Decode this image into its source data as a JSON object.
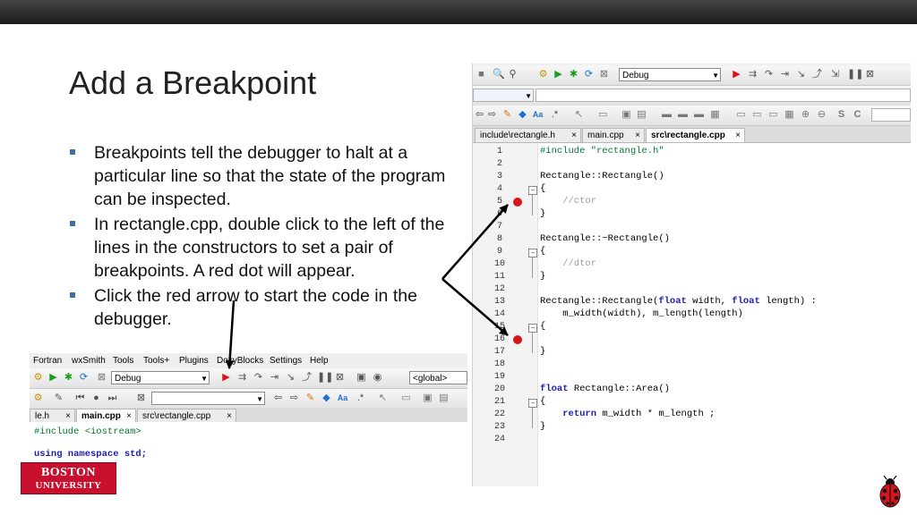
{
  "slide": {
    "title": "Add a Breakpoint",
    "bullets": [
      "Breakpoints tell the debugger to halt at a particular line so that the state of the program can be inspected.",
      "In rectangle.cpp, double click to the left of the lines in the constructors to set a pair of breakpoints. A red dot will appear.",
      "Click the red arrow to start the code in the debugger."
    ],
    "logo": {
      "line1": "BOSTON",
      "line2": "UNIVERSITY"
    }
  },
  "ide_right": {
    "build_target": "Debug",
    "tabs": [
      {
        "label": "include\\rectangle.h",
        "close": "×"
      },
      {
        "label": "main.cpp",
        "close": "×"
      },
      {
        "label": "src\\rectangle.cpp",
        "close": "×"
      }
    ],
    "lines": [
      {
        "n": "1",
        "code": "#include \"rectangle.h\""
      },
      {
        "n": "2",
        "code": ""
      },
      {
        "n": "3",
        "code": "Rectangle::Rectangle()"
      },
      {
        "n": "4",
        "code": "{"
      },
      {
        "n": "5",
        "code": "    //ctor"
      },
      {
        "n": "6",
        "code": "}"
      },
      {
        "n": "7",
        "code": ""
      },
      {
        "n": "8",
        "code": "Rectangle::~Rectangle()"
      },
      {
        "n": "9",
        "code": "{"
      },
      {
        "n": "10",
        "code": "    //dtor"
      },
      {
        "n": "11",
        "code": "}"
      },
      {
        "n": "12",
        "code": ""
      },
      {
        "n": "13",
        "code": "Rectangle::Rectangle(float width, float length) :"
      },
      {
        "n": "14",
        "code": "    m_width(width), m_length(length)"
      },
      {
        "n": "15",
        "code": "{"
      },
      {
        "n": "16",
        "code": ""
      },
      {
        "n": "17",
        "code": "}"
      },
      {
        "n": "18",
        "code": ""
      },
      {
        "n": "19",
        "code": ""
      },
      {
        "n": "20",
        "code": "float Rectangle::Area()"
      },
      {
        "n": "21",
        "code": "{"
      },
      {
        "n": "22",
        "code": "    return m_width * m_length ;"
      },
      {
        "n": "23",
        "code": "}"
      },
      {
        "n": "24",
        "code": ""
      }
    ],
    "breakpoint_lines": [
      "5",
      "16"
    ],
    "colors": {
      "breakpoint": "#d9151c",
      "keyword": "#1e1eb4",
      "preprocessor": "#007a33",
      "comment": "#9a9a9a"
    }
  },
  "ide_bottom": {
    "menu": [
      "Fortran",
      "wxSmith",
      "Tools",
      "Tools+",
      "Plugins",
      "DoxyBlocks",
      "Settings",
      "Help"
    ],
    "build_target": "Debug",
    "scope": "<global>",
    "tabs": [
      {
        "label": "le.h",
        "close": "×"
      },
      {
        "label": "main.cpp",
        "close": "×"
      },
      {
        "label": "src\\rectangle.cpp",
        "close": "×"
      }
    ],
    "code_lines": [
      "#include <iostream>",
      "using namespace std;"
    ]
  }
}
